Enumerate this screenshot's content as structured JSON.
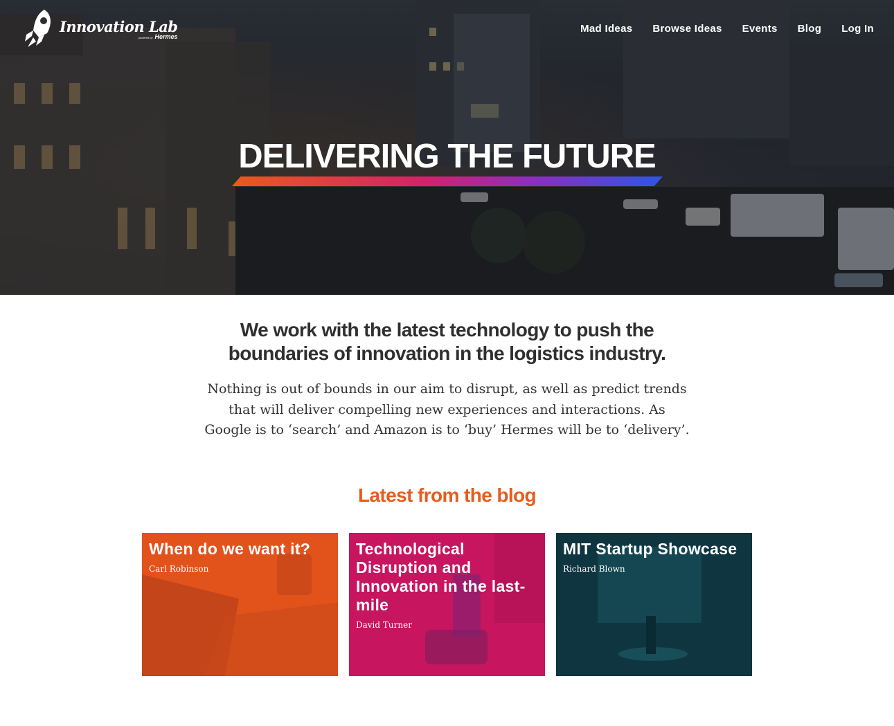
{
  "brand": {
    "name": "Innovation Lab",
    "powered_by": "powered by",
    "parent": "Hermes"
  },
  "nav": {
    "items": [
      {
        "label": "Mad Ideas"
      },
      {
        "label": "Browse Ideas"
      },
      {
        "label": "Events"
      },
      {
        "label": "Blog"
      },
      {
        "label": "Log In"
      }
    ]
  },
  "hero": {
    "title": "DELIVERING THE FUTURE"
  },
  "intro": {
    "heading": "We work with the latest technology to push the boundaries of innovation in the logistics industry.",
    "body": "Nothing is out of bounds in our aim to disrupt, as well as predict trends that will deliver compelling new experiences and interactions. As Google is to ‘search’ and Amazon is to ‘buy’ Hermes will be to ‘delivery’."
  },
  "blog": {
    "heading": "Latest from the blog",
    "posts": [
      {
        "title": "When do we want it?",
        "author": "Carl Robinson"
      },
      {
        "title": "Technological Disruption and Innovation in the last-mile",
        "author": "David Turner"
      },
      {
        "title": "MIT Startup Showcase",
        "author": "Richard Blown"
      }
    ]
  },
  "colors": {
    "accent_orange": "#e85b1c",
    "card_orange": "#e2531c",
    "card_magenta": "#c8155f",
    "card_teal": "#0f3540",
    "gradient_blue": "#2f55e6"
  }
}
